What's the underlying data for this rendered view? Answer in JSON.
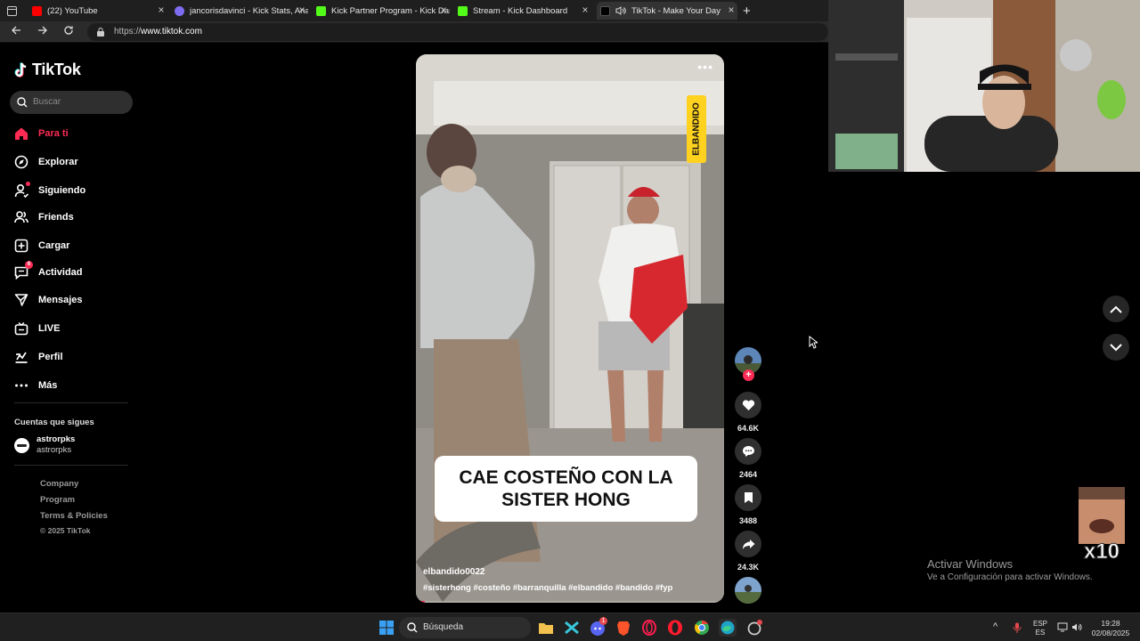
{
  "browser": {
    "tabs": [
      {
        "title": "(22) YouTube",
        "color": "#ff0000",
        "active": false
      },
      {
        "title": "jancorisdavinci - Kick Stats, Analy",
        "color": "#7d6cf0",
        "active": false
      },
      {
        "title": "Kick Partner Program - Kick Dashb",
        "color": "#53fc18",
        "active": false
      },
      {
        "title": "Stream - Kick Dashboard",
        "color": "#53fc18",
        "active": false
      },
      {
        "title": "TikTok - Make Your Day",
        "color": "#ffffff",
        "active": true
      }
    ],
    "new_tab": "+",
    "url_scheme": "https://",
    "url_host": "www.tiktok.com"
  },
  "sidebar": {
    "logo_text": "TikTok",
    "search_placeholder": "Buscar",
    "nav": [
      {
        "label": "Para ti",
        "icon": "home-icon",
        "active": true
      },
      {
        "label": "Explorar",
        "icon": "compass-icon"
      },
      {
        "label": "Siguiendo",
        "icon": "following-icon"
      },
      {
        "label": "Friends",
        "icon": "friends-icon"
      },
      {
        "label": "Cargar",
        "icon": "upload-icon"
      },
      {
        "label": "Actividad",
        "icon": "activity-icon",
        "badge": "6"
      },
      {
        "label": "Mensajes",
        "icon": "messages-icon"
      },
      {
        "label": "LIVE",
        "icon": "live-icon"
      },
      {
        "label": "Perfil",
        "icon": "profile-icon"
      },
      {
        "label": "Más",
        "icon": "more-icon"
      }
    ],
    "following_title": "Cuentas que sigues",
    "following": [
      {
        "name": "astrorpks",
        "username": "astrorpks"
      }
    ],
    "footer": [
      "Company",
      "Program",
      "Terms & Policies"
    ],
    "copyright": "© 2025 TikTok"
  },
  "video": {
    "more": "•••",
    "tag": "ELBANDIDO",
    "caption": "CAE COSTEÑO CON LA SISTER HONG",
    "creator": "elbandido0022",
    "hashtags": "#sisterhong  #costeño  #barranquilla  #elbandido  #bandido  #fyp",
    "progress": 0.03
  },
  "actions": {
    "likes": "64.6K",
    "comments": "2464",
    "saves": "3488",
    "shares": "24.3K",
    "follow_plus": "+"
  },
  "overlay": {
    "activate_title": "Activar Windows",
    "activate_sub": "Ve a Configuración para activar Windows.",
    "meme_text": "x10"
  },
  "taskbar": {
    "search_placeholder": "Búsqueda",
    "lang_top": "ESP",
    "lang_bottom": "ES",
    "time": "19:28",
    "date": "02/08/2025",
    "discord_badge": "1"
  },
  "colors": {
    "accent": "#fe2c55",
    "background": "#000000"
  }
}
